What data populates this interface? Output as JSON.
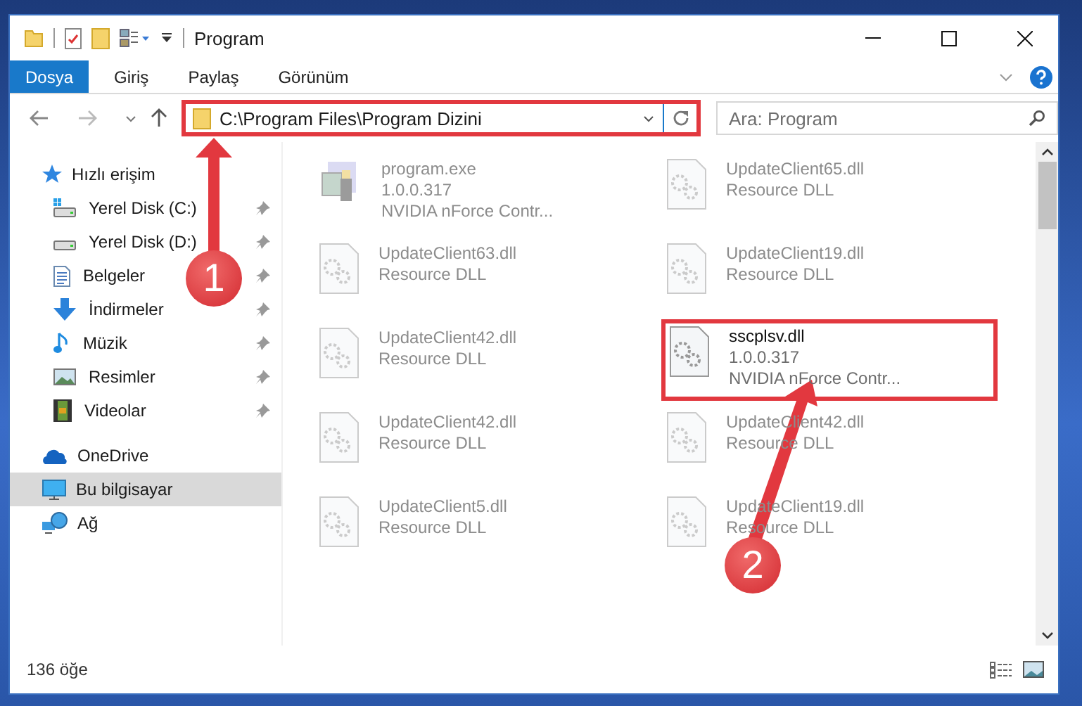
{
  "window": {
    "title": "Program"
  },
  "ribbon": {
    "tabs": [
      {
        "label": "Dosya",
        "kind": "file"
      },
      {
        "label": "Giriş",
        "kind": "tab"
      },
      {
        "label": "Paylaş",
        "kind": "tab"
      },
      {
        "label": "Görünüm",
        "kind": "tab"
      }
    ]
  },
  "address_bar": {
    "path": "C:\\Program Files\\Program Dizini",
    "highlighted": true
  },
  "search": {
    "placeholder": "Ara: Program"
  },
  "sidebar": {
    "items": [
      {
        "label": "Hızlı erişim",
        "kind": "star",
        "selected": false,
        "children": [
          {
            "label": "Yerel Disk (C:)",
            "kind": "drive-system",
            "pinned": true
          },
          {
            "label": "Yerel Disk (D:)",
            "kind": "drive",
            "pinned": true
          },
          {
            "label": "Belgeler",
            "kind": "documents",
            "pinned": true
          },
          {
            "label": "İndirmeler",
            "kind": "downloads",
            "pinned": true
          },
          {
            "label": "Müzik",
            "kind": "music",
            "pinned": true
          },
          {
            "label": "Resimler",
            "kind": "pictures",
            "pinned": true
          },
          {
            "label": "Videolar",
            "kind": "videos",
            "pinned": true
          }
        ]
      },
      {
        "label": "OneDrive",
        "kind": "cloud",
        "selected": false
      },
      {
        "label": "Bu bilgisayar",
        "kind": "computer",
        "selected": true
      },
      {
        "label": "Ağ",
        "kind": "network",
        "selected": false
      }
    ]
  },
  "files": [
    {
      "name": "program.exe",
      "details": [
        "1.0.0.317",
        "NVIDIA nForce Contr..."
      ],
      "kind": "exe",
      "dimmed": true,
      "highlighted": false
    },
    {
      "name": "UpdateClient65.dll",
      "details": [
        "Resource DLL"
      ],
      "kind": "dll",
      "dimmed": true,
      "highlighted": false
    },
    {
      "name": "UpdateClient63.dll",
      "details": [
        "Resource DLL"
      ],
      "kind": "dll",
      "dimmed": true,
      "highlighted": false
    },
    {
      "name": "UpdateClient19.dll",
      "details": [
        "Resource DLL"
      ],
      "kind": "dll",
      "dimmed": true,
      "highlighted": false
    },
    {
      "name": "UpdateClient42.dll",
      "details": [
        "Resource DLL"
      ],
      "kind": "dll",
      "dimmed": true,
      "highlighted": false
    },
    {
      "name": "sscplsv.dll",
      "details": [
        "1.0.0.317",
        "NVIDIA nForce Contr..."
      ],
      "kind": "dll",
      "dimmed": false,
      "highlighted": true
    },
    {
      "name": "UpdateClient42.dll",
      "details": [
        "Resource DLL"
      ],
      "kind": "dll",
      "dimmed": true,
      "highlighted": false
    },
    {
      "name": "UpdateClient42.dll",
      "details": [
        "Resource DLL"
      ],
      "kind": "dll",
      "dimmed": true,
      "highlighted": false
    },
    {
      "name": "UpdateClient5.dll",
      "details": [
        "Resource DLL"
      ],
      "kind": "dll",
      "dimmed": true,
      "highlighted": false
    },
    {
      "name": "UpdateClient19.dll",
      "details": [
        "Resource DLL"
      ],
      "kind": "dll",
      "dimmed": true,
      "highlighted": false
    }
  ],
  "callouts": [
    {
      "number": "1"
    },
    {
      "number": "2"
    }
  ],
  "status_bar": {
    "count": "136 öğe"
  }
}
